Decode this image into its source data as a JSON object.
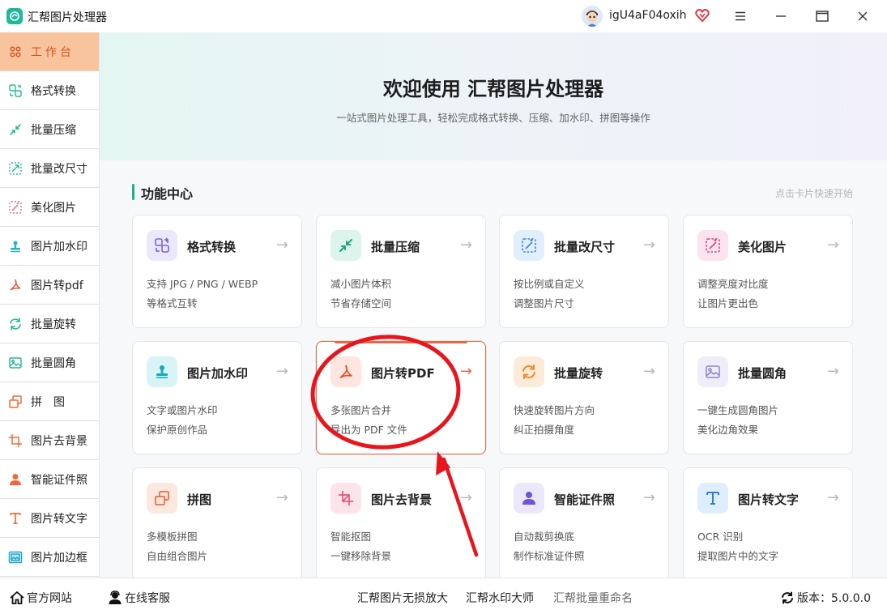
{
  "app": {
    "title": "汇帮图片处理器"
  },
  "user": {
    "name": "igU4aF04oxih"
  },
  "colors": {
    "accent": "#19b394",
    "active_bg": "#f7c49e",
    "active_text": "#d9531e",
    "highlight": "#e06a4a"
  },
  "sidebar": {
    "items": [
      {
        "label": "工作台",
        "icon": "grid-icon",
        "active": true
      },
      {
        "label": "格式转换",
        "icon": "convert-icon"
      },
      {
        "label": "批量压缩",
        "icon": "compress-icon"
      },
      {
        "label": "批量改尺寸",
        "icon": "resize-icon"
      },
      {
        "label": "美化图片",
        "icon": "beautify-icon"
      },
      {
        "label": "图片加水印",
        "icon": "stamp-icon"
      },
      {
        "label": "图片转pdf",
        "icon": "pdf-icon"
      },
      {
        "label": "批量旋转",
        "icon": "rotate-icon"
      },
      {
        "label": "批量圆角",
        "icon": "image-icon"
      },
      {
        "label": "拼　图",
        "icon": "collage-icon"
      },
      {
        "label": "图片去背景",
        "icon": "crop-icon"
      },
      {
        "label": "智能证件照",
        "icon": "person-icon"
      },
      {
        "label": "图片转文字",
        "icon": "text-icon"
      },
      {
        "label": "图片加边框",
        "icon": "frame-icon"
      }
    ]
  },
  "banner": {
    "title": "欢迎使用 汇帮图片处理器",
    "subtitle": "一站式图片处理工具，轻松完成格式转换、压缩、加水印、拼图等操作"
  },
  "section": {
    "title": "功能中心",
    "hint": "点击卡片快速开始"
  },
  "cards": [
    {
      "title": "格式转换",
      "desc1": "支持 JPG / PNG / WEBP",
      "desc2": "等格式互转",
      "arrow": "→"
    },
    {
      "title": "批量压缩",
      "desc1": "减小图片体积",
      "desc2": "节省存储空间",
      "arrow": "→"
    },
    {
      "title": "批量改尺寸",
      "desc1": "按比例或自定义",
      "desc2": "调整图片尺寸",
      "arrow": "→"
    },
    {
      "title": "美化图片",
      "desc1": "调整亮度对比度",
      "desc2": "让图片更出色",
      "arrow": "→"
    },
    {
      "title": "图片加水印",
      "desc1": "文字或图片水印",
      "desc2": "保护原创作品",
      "arrow": "→"
    },
    {
      "title": "图片转PDF",
      "desc1": "多张图片合并",
      "desc2": "导出为 PDF 文件",
      "arrow": "→"
    },
    {
      "title": "批量旋转",
      "desc1": "快速旋转图片方向",
      "desc2": "纠正拍摄角度",
      "arrow": "→"
    },
    {
      "title": "批量圆角",
      "desc1": "一键生成圆角图片",
      "desc2": "美化边角效果",
      "arrow": "→"
    },
    {
      "title": "拼图",
      "desc1": "多模板拼图",
      "desc2": "自由组合图片",
      "arrow": "→"
    },
    {
      "title": "图片去背景",
      "desc1": "智能抠图",
      "desc2": "一键移除背景",
      "arrow": "→"
    },
    {
      "title": "智能证件照",
      "desc1": "自动裁剪换底",
      "desc2": "制作标准证件照",
      "arrow": "→"
    },
    {
      "title": "图片转文字",
      "desc1": "OCR 识别",
      "desc2": "提取图片中的文字",
      "arrow": "→"
    }
  ],
  "footer": {
    "website": "官方网站",
    "support": "在线客服",
    "link1": "汇帮图片无损放大",
    "link2": "汇帮水印大师",
    "link3": "汇帮批量重命名",
    "version": "版本：5.0.0.0"
  }
}
